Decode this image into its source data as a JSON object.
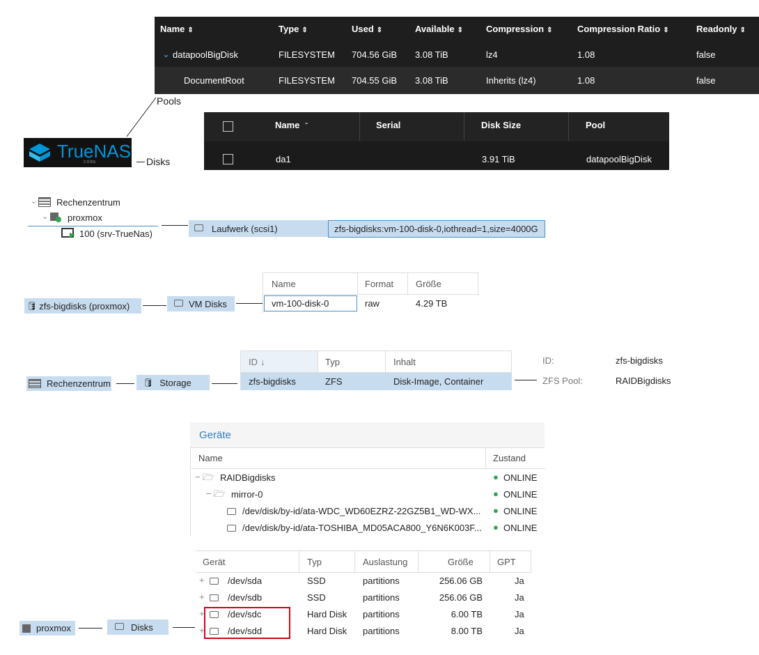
{
  "pools_table": {
    "headers": [
      "Name",
      "Type",
      "Used",
      "Available",
      "Compression",
      "Compression Ratio",
      "Readonly"
    ],
    "rows": [
      [
        "datapoolBigDisk",
        "FILESYSTEM",
        "704.56 GiB",
        "3.08 TiB",
        "lz4",
        "1.08",
        "false"
      ],
      [
        "DocumentRoot",
        "FILESYSTEM",
        "704.55 GiB",
        "3.08 TiB",
        "Inherits (lz4)",
        "1.08",
        "false"
      ]
    ]
  },
  "labels": {
    "pools": "Pools",
    "disks": "Disks"
  },
  "truenas_logo": {
    "name": "TrueNAS",
    "edition": "CORE"
  },
  "disks_table": {
    "headers": [
      "Name",
      "Serial",
      "Disk Size",
      "Pool"
    ],
    "row": [
      "da1",
      "",
      "3.91 TiB",
      "datapoolBigDisk"
    ]
  },
  "tree": {
    "datacenter": "Rechenzentrum",
    "node": "proxmox",
    "vm": "100 (srv-TrueNas)"
  },
  "hw_row": {
    "label": "Laufwerk (scsi1)",
    "value": "zfs-bigdisks:vm-100-disk-0,iothread=1,size=4000G"
  },
  "vmdisks_row": {
    "storage": "zfs-bigdisks (proxmox)",
    "tab": "VM Disks",
    "headers": [
      "Name",
      "Format",
      "Größe"
    ],
    "row": [
      "vm-100-disk-0",
      "raw",
      "4.29 TB"
    ]
  },
  "storage_row": {
    "datacenter": "Rechenzentrum",
    "tab": "Storage",
    "headers": [
      "ID",
      "Typ",
      "Inhalt"
    ],
    "row": [
      "zfs-bigdisks",
      "ZFS",
      "Disk-Image, Container"
    ],
    "detail": [
      {
        "key": "ID:",
        "value": "zfs-bigdisks"
      },
      {
        "key": "ZFS Pool:",
        "value": "RAIDBigdisks"
      }
    ]
  },
  "geraete": {
    "title": "Geräte",
    "headers": [
      "Name",
      "Zustand"
    ],
    "rows": [
      {
        "name": "RAIDBigdisks",
        "state": "ONLINE"
      },
      {
        "name": "mirror-0",
        "state": "ONLINE"
      },
      {
        "name": "/dev/disk/by-id/ata-WDC_WD60EZRZ-22GZ5B1_WD-WX...",
        "state": "ONLINE"
      },
      {
        "name": "/dev/disk/by-id/ata-TOSHIBA_MD05ACA800_Y6N6K003F...",
        "state": "ONLINE"
      }
    ]
  },
  "node_disks": {
    "node": "proxmox",
    "tab": "Disks",
    "headers": [
      "Gerät",
      "Typ",
      "Auslastung",
      "Größe",
      "GPT"
    ],
    "rows": [
      [
        "/dev/sda",
        "SSD",
        "partitions",
        "256.06 GB",
        "Ja"
      ],
      [
        "/dev/sdb",
        "SSD",
        "partitions",
        "256.06 GB",
        "Ja"
      ],
      [
        "/dev/sdc",
        "Hard Disk",
        "partitions",
        "6.00 TB",
        "Ja"
      ],
      [
        "/dev/sdd",
        "Hard Disk",
        "partitions",
        "8.00 TB",
        "Ja"
      ]
    ],
    "highlight_color": "#d0021b"
  }
}
